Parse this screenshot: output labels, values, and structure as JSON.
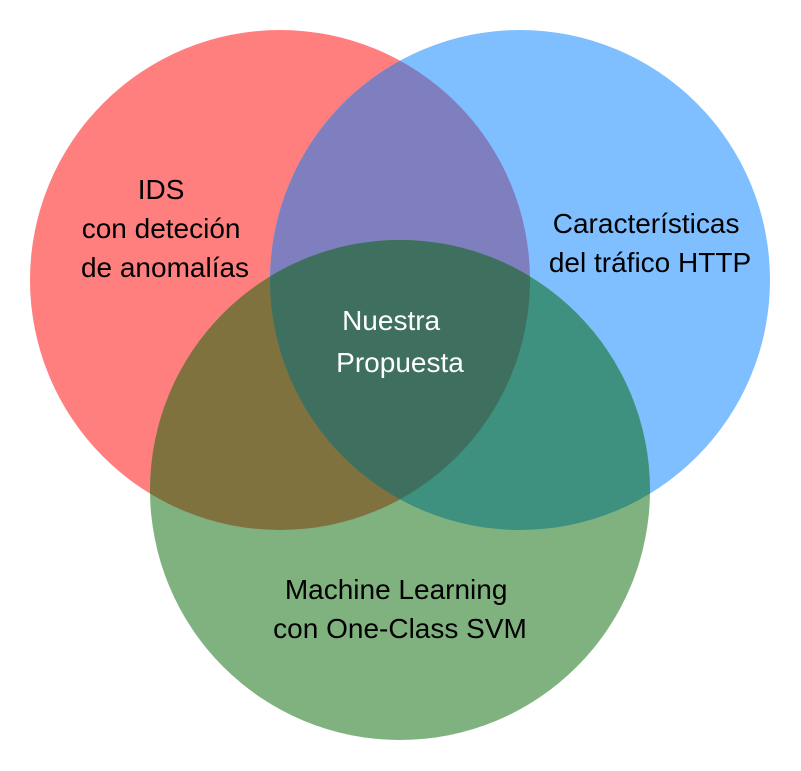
{
  "diagram": {
    "sets": [
      {
        "id": "ids",
        "lines": [
          "IDS",
          "con deteción",
          "de anomalías"
        ],
        "color": "#ff7f7f",
        "text_color": "#000000"
      },
      {
        "id": "http",
        "lines": [
          "Características",
          "del tráfico HTTP"
        ],
        "color": "#7fbfff",
        "text_color": "#000000"
      },
      {
        "id": "ml",
        "lines": [
          "Machine Learning",
          "con One-Class SVM"
        ],
        "color": "#7fb27f",
        "text_color": "#000000"
      }
    ],
    "intersections": {
      "ids_http": "#7f7fbf",
      "ids_ml": "#7f723f",
      "http_ml": "#3f917f",
      "all": "#3f6f5f"
    },
    "center": {
      "lines": [
        "Nuestra",
        "Propuesta"
      ],
      "text_color": "#ffffff"
    }
  }
}
